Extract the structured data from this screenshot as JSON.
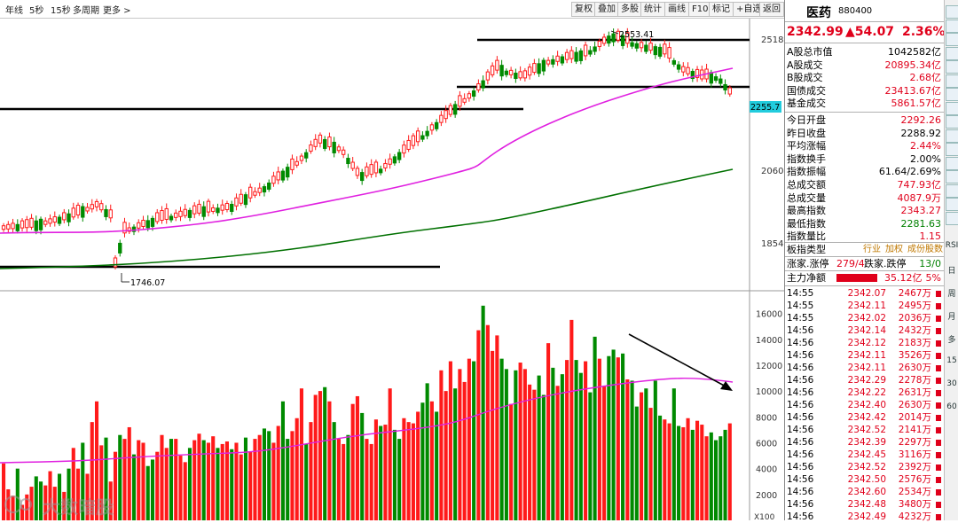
{
  "toolbar": {
    "left": [
      "年线",
      "5秒",
      "15秒",
      "多周期",
      "更多 >"
    ],
    "right": [
      "复权",
      "叠加",
      "多股",
      "统计",
      "画线",
      "F10",
      "标记",
      "+自选",
      "返回"
    ]
  },
  "chart": {
    "price_labels": [
      "2518",
      "2060",
      "1854"
    ],
    "hidden_label": "2255.7",
    "high_annotation": "2553.41",
    "low_annotation": "1746.07",
    "volume_labels": [
      "16000",
      "14000",
      "12000",
      "10000",
      "8000",
      "6000",
      "4000",
      "2000"
    ],
    "volume_unit": "X100"
  },
  "chart_data": {
    "type": "bar",
    "title": "医药 880400",
    "price_axis": [
      1750,
      2560
    ],
    "volume_axis": [
      0,
      17000
    ],
    "volume_values": [
      4400,
      2400,
      1900,
      4000,
      1200,
      2000,
      2600,
      3400,
      3000,
      2700,
      3800,
      2600,
      3600,
      2200,
      4000,
      5600,
      4000,
      6000,
      3600,
      7600,
      9200,
      5800,
      6400,
      3000,
      5300,
      6600,
      6300,
      7200,
      5100,
      6200,
      6000,
      4200,
      4700,
      5300,
      6600,
      5600,
      6300,
      6300,
      5000,
      4500,
      5600,
      6200,
      6700,
      6200,
      6000,
      6500,
      5600,
      5900,
      6100,
      5500,
      6000,
      5100,
      6400,
      5300,
      6300,
      6600,
      7100,
      6900,
      6000,
      7300,
      9200,
      6300,
      6900,
      7900,
      10200,
      5900,
      7600,
      9700,
      10000,
      10300,
      9200,
      7600,
      6300,
      5900,
      6600,
      9000,
      9600,
      8300,
      6300,
      5900,
      7800,
      7300,
      7400,
      10200,
      7000,
      6300,
      7900,
      7600,
      7500,
      8400,
      9100,
      10600,
      9200,
      8400,
      11600,
      10000,
      12300,
      10200,
      11700,
      10700,
      12500,
      12300,
      14700,
      16600,
      15100,
      13100,
      14300,
      12500,
      11700,
      9000,
      11600,
      12200,
      11700,
      10500,
      10100,
      11200,
      9700,
      13700,
      11800,
      10400,
      11300,
      12400,
      15500,
      12400,
      11400,
      12300,
      9900,
      14200,
      12500,
      10400,
      12700,
      13200,
      12600,
      12900,
      10900,
      10800,
      8800,
      9900,
      10200,
      8700,
      10800,
      8100,
      7800,
      7500,
      10200,
      7300,
      7200,
      7900,
      7000,
      7700,
      7400,
      6500,
      6800,
      6200,
      6500,
      7000,
      7500
    ]
  },
  "quote": {
    "name": "医药",
    "code": "880400",
    "price": "2342.99",
    "change": "▲54.07",
    "pct": "2.36%",
    "rows1": [
      {
        "label": "A股总市值",
        "value": "1042582亿",
        "cls": "blk"
      },
      {
        "label": "A股成交",
        "value": "20895.34亿",
        "cls": "red"
      },
      {
        "label": "B股成交",
        "value": "2.68亿",
        "cls": "red"
      },
      {
        "label": "国债成交",
        "value": "23413.67亿",
        "cls": "red"
      },
      {
        "label": "基金成交",
        "value": "5861.57亿",
        "cls": "red"
      }
    ],
    "rows2": [
      {
        "label": "今日开盘",
        "value": "2292.26",
        "cls": "red"
      },
      {
        "label": "昨日收盘",
        "value": "2288.92",
        "cls": "blk"
      },
      {
        "label": "平均涨幅",
        "value": "2.44%",
        "cls": "red"
      },
      {
        "label": "指数换手",
        "value": "2.00%",
        "cls": "blk"
      },
      {
        "label": "指数振幅",
        "value": "61.64/2.69%",
        "cls": "blk"
      },
      {
        "label": "总成交额",
        "value": "747.93亿",
        "cls": "red"
      },
      {
        "label": "总成交量",
        "value": "4087.9万",
        "cls": "red"
      },
      {
        "label": "最高指数",
        "value": "2343.27",
        "cls": "red"
      },
      {
        "label": "最低指数",
        "value": "2281.63",
        "cls": "grn"
      },
      {
        "label": "指数量比",
        "value": "1.15",
        "cls": "red"
      }
    ],
    "board_label": "板指类型",
    "board_values": [
      "行业",
      "加权",
      "成份股数"
    ],
    "updown": {
      "l1": "涨家.涨停",
      "v1": "279/4",
      "l2": "跌家.跌停",
      "v2": "13/0"
    },
    "mainflow": {
      "label": "主力净额",
      "value": "35.12亿",
      "pct": "5%"
    }
  },
  "ticks": [
    {
      "t": "14:55",
      "p": "2342.07",
      "v": "2467万"
    },
    {
      "t": "14:55",
      "p": "2342.11",
      "v": "2495万"
    },
    {
      "t": "14:55",
      "p": "2342.02",
      "v": "2036万"
    },
    {
      "t": "14:56",
      "p": "2342.14",
      "v": "2432万"
    },
    {
      "t": "14:56",
      "p": "2342.12",
      "v": "2183万"
    },
    {
      "t": "14:56",
      "p": "2342.11",
      "v": "3526万"
    },
    {
      "t": "14:56",
      "p": "2342.11",
      "v": "2630万"
    },
    {
      "t": "14:56",
      "p": "2342.29",
      "v": "2278万"
    },
    {
      "t": "14:56",
      "p": "2342.22",
      "v": "2631万"
    },
    {
      "t": "14:56",
      "p": "2342.40",
      "v": "2630万"
    },
    {
      "t": "14:56",
      "p": "2342.42",
      "v": "2014万"
    },
    {
      "t": "14:56",
      "p": "2342.52",
      "v": "2141万"
    },
    {
      "t": "14:56",
      "p": "2342.39",
      "v": "2297万"
    },
    {
      "t": "14:56",
      "p": "2342.45",
      "v": "3116万"
    },
    {
      "t": "14:56",
      "p": "2342.52",
      "v": "2392万"
    },
    {
      "t": "14:56",
      "p": "2342.50",
      "v": "2576万"
    },
    {
      "t": "14:56",
      "p": "2342.60",
      "v": "2534万"
    },
    {
      "t": "14:56",
      "p": "2342.48",
      "v": "3480万"
    },
    {
      "t": "14:56",
      "p": "2342.49",
      "v": "4232万"
    }
  ],
  "sidebar": [
    "RSI",
    "日",
    "周",
    "月",
    "多",
    "15",
    "30",
    "60"
  ],
  "watermark": "大数暗股"
}
